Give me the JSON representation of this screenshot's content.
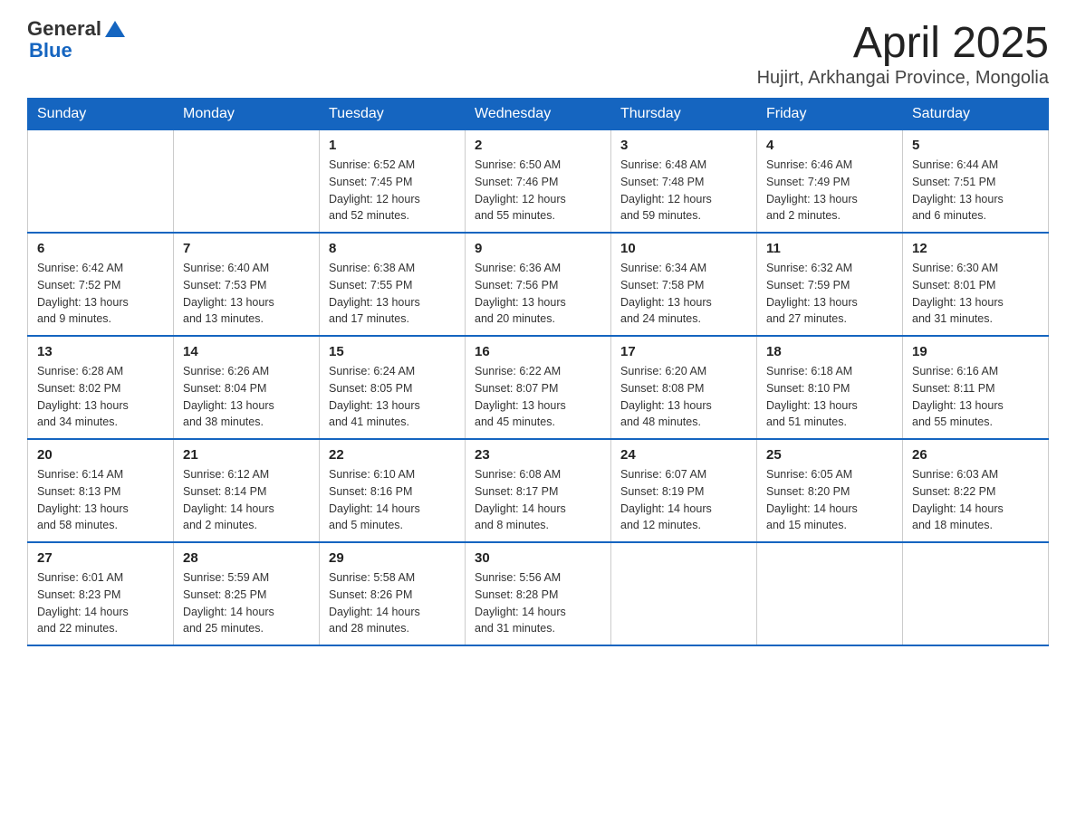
{
  "logo": {
    "text_general": "General",
    "text_blue": "Blue"
  },
  "title": "April 2025",
  "subtitle": "Hujirt, Arkhangai Province, Mongolia",
  "headers": [
    "Sunday",
    "Monday",
    "Tuesday",
    "Wednesday",
    "Thursday",
    "Friday",
    "Saturday"
  ],
  "weeks": [
    [
      {
        "day": "",
        "info": ""
      },
      {
        "day": "",
        "info": ""
      },
      {
        "day": "1",
        "info": "Sunrise: 6:52 AM\nSunset: 7:45 PM\nDaylight: 12 hours\nand 52 minutes."
      },
      {
        "day": "2",
        "info": "Sunrise: 6:50 AM\nSunset: 7:46 PM\nDaylight: 12 hours\nand 55 minutes."
      },
      {
        "day": "3",
        "info": "Sunrise: 6:48 AM\nSunset: 7:48 PM\nDaylight: 12 hours\nand 59 minutes."
      },
      {
        "day": "4",
        "info": "Sunrise: 6:46 AM\nSunset: 7:49 PM\nDaylight: 13 hours\nand 2 minutes."
      },
      {
        "day": "5",
        "info": "Sunrise: 6:44 AM\nSunset: 7:51 PM\nDaylight: 13 hours\nand 6 minutes."
      }
    ],
    [
      {
        "day": "6",
        "info": "Sunrise: 6:42 AM\nSunset: 7:52 PM\nDaylight: 13 hours\nand 9 minutes."
      },
      {
        "day": "7",
        "info": "Sunrise: 6:40 AM\nSunset: 7:53 PM\nDaylight: 13 hours\nand 13 minutes."
      },
      {
        "day": "8",
        "info": "Sunrise: 6:38 AM\nSunset: 7:55 PM\nDaylight: 13 hours\nand 17 minutes."
      },
      {
        "day": "9",
        "info": "Sunrise: 6:36 AM\nSunset: 7:56 PM\nDaylight: 13 hours\nand 20 minutes."
      },
      {
        "day": "10",
        "info": "Sunrise: 6:34 AM\nSunset: 7:58 PM\nDaylight: 13 hours\nand 24 minutes."
      },
      {
        "day": "11",
        "info": "Sunrise: 6:32 AM\nSunset: 7:59 PM\nDaylight: 13 hours\nand 27 minutes."
      },
      {
        "day": "12",
        "info": "Sunrise: 6:30 AM\nSunset: 8:01 PM\nDaylight: 13 hours\nand 31 minutes."
      }
    ],
    [
      {
        "day": "13",
        "info": "Sunrise: 6:28 AM\nSunset: 8:02 PM\nDaylight: 13 hours\nand 34 minutes."
      },
      {
        "day": "14",
        "info": "Sunrise: 6:26 AM\nSunset: 8:04 PM\nDaylight: 13 hours\nand 38 minutes."
      },
      {
        "day": "15",
        "info": "Sunrise: 6:24 AM\nSunset: 8:05 PM\nDaylight: 13 hours\nand 41 minutes."
      },
      {
        "day": "16",
        "info": "Sunrise: 6:22 AM\nSunset: 8:07 PM\nDaylight: 13 hours\nand 45 minutes."
      },
      {
        "day": "17",
        "info": "Sunrise: 6:20 AM\nSunset: 8:08 PM\nDaylight: 13 hours\nand 48 minutes."
      },
      {
        "day": "18",
        "info": "Sunrise: 6:18 AM\nSunset: 8:10 PM\nDaylight: 13 hours\nand 51 minutes."
      },
      {
        "day": "19",
        "info": "Sunrise: 6:16 AM\nSunset: 8:11 PM\nDaylight: 13 hours\nand 55 minutes."
      }
    ],
    [
      {
        "day": "20",
        "info": "Sunrise: 6:14 AM\nSunset: 8:13 PM\nDaylight: 13 hours\nand 58 minutes."
      },
      {
        "day": "21",
        "info": "Sunrise: 6:12 AM\nSunset: 8:14 PM\nDaylight: 14 hours\nand 2 minutes."
      },
      {
        "day": "22",
        "info": "Sunrise: 6:10 AM\nSunset: 8:16 PM\nDaylight: 14 hours\nand 5 minutes."
      },
      {
        "day": "23",
        "info": "Sunrise: 6:08 AM\nSunset: 8:17 PM\nDaylight: 14 hours\nand 8 minutes."
      },
      {
        "day": "24",
        "info": "Sunrise: 6:07 AM\nSunset: 8:19 PM\nDaylight: 14 hours\nand 12 minutes."
      },
      {
        "day": "25",
        "info": "Sunrise: 6:05 AM\nSunset: 8:20 PM\nDaylight: 14 hours\nand 15 minutes."
      },
      {
        "day": "26",
        "info": "Sunrise: 6:03 AM\nSunset: 8:22 PM\nDaylight: 14 hours\nand 18 minutes."
      }
    ],
    [
      {
        "day": "27",
        "info": "Sunrise: 6:01 AM\nSunset: 8:23 PM\nDaylight: 14 hours\nand 22 minutes."
      },
      {
        "day": "28",
        "info": "Sunrise: 5:59 AM\nSunset: 8:25 PM\nDaylight: 14 hours\nand 25 minutes."
      },
      {
        "day": "29",
        "info": "Sunrise: 5:58 AM\nSunset: 8:26 PM\nDaylight: 14 hours\nand 28 minutes."
      },
      {
        "day": "30",
        "info": "Sunrise: 5:56 AM\nSunset: 8:28 PM\nDaylight: 14 hours\nand 31 minutes."
      },
      {
        "day": "",
        "info": ""
      },
      {
        "day": "",
        "info": ""
      },
      {
        "day": "",
        "info": ""
      }
    ]
  ]
}
